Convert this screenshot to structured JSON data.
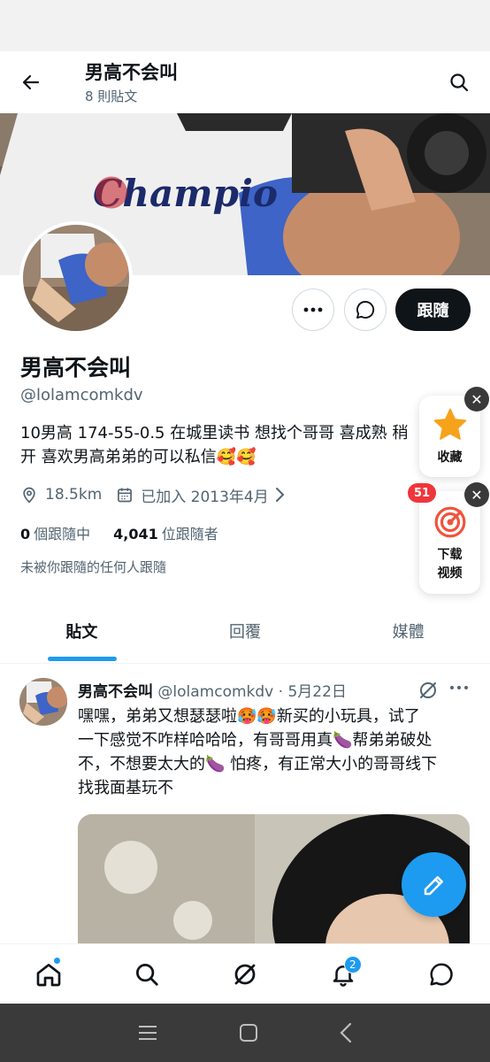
{
  "header": {
    "title": "男高不会叫",
    "post_count": "8 則貼文"
  },
  "profile": {
    "name": "男高不会叫",
    "handle": "@lolamcomkdv",
    "bio_lines": [
      "10男高 174-55-0.5 在城里读书 想找个哥哥 喜成熟 稍",
      "开 喜欢男高弟弟的可以私信🥰🥰"
    ],
    "location": "18.5km",
    "joined": "已加入 2013年4月",
    "following_count": "0",
    "following_label": "個跟隨中",
    "followers_count": "4,041",
    "followers_label": "位跟隨者",
    "not_followed_text": "未被你跟隨的任何人跟隨",
    "follow_button": "跟隨",
    "banner_text": "Champio"
  },
  "floating": {
    "favorite_label": "收藏",
    "download_label_1": "下载",
    "download_label_2": "视频",
    "badge_count": "51",
    "close_glyph": "✕"
  },
  "tabs": [
    {
      "label": "貼文",
      "active": true
    },
    {
      "label": "回覆",
      "active": false
    },
    {
      "label": "媒體",
      "active": false
    }
  ],
  "tweet": {
    "name": "男高不会叫",
    "handle_date": "@lolamcomkdv · 5月22日",
    "lines": [
      "嘿嘿，弟弟又想瑟瑟啦🥵🥵新买的小玩具，试了",
      "一下感觉不咋样哈哈哈，有哥哥用真🍆帮弟弟破处",
      "不，不想要太大的🍆 怕疼，有正常大小的哥哥线下",
      "找我面基玩不"
    ]
  },
  "nav": {
    "notifications_badge": "2"
  },
  "colors": {
    "accent": "#1d9bf0",
    "text": "#0f1419",
    "muted": "#536471",
    "badge_red": "#f0353b"
  }
}
